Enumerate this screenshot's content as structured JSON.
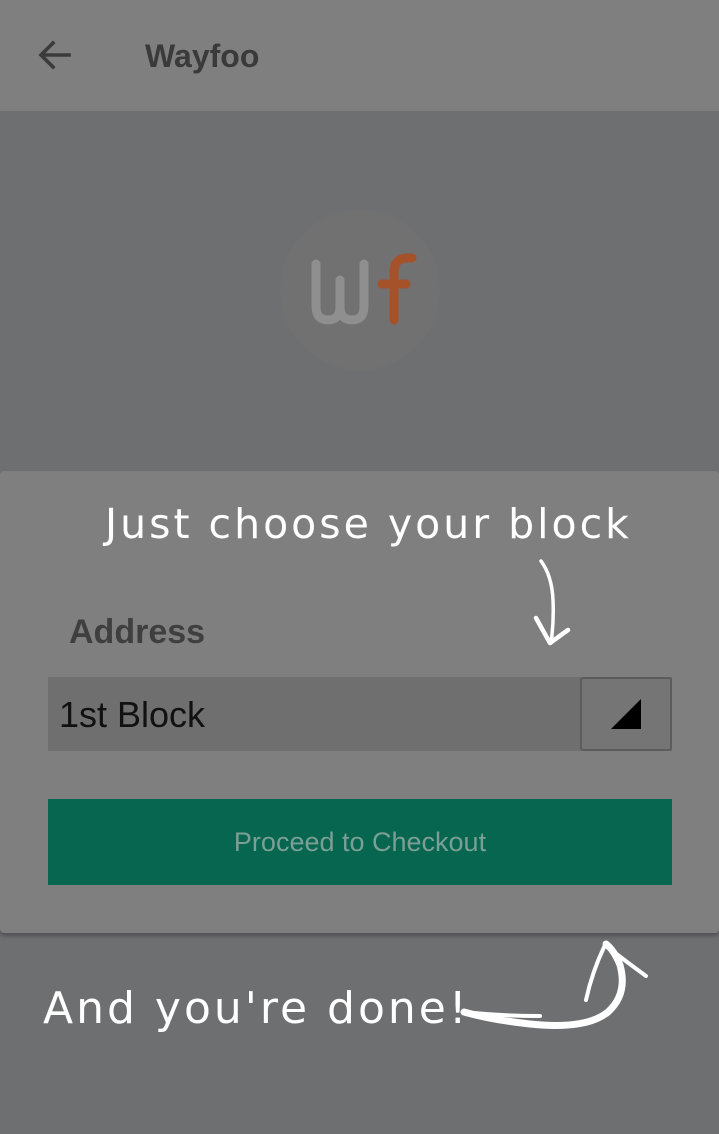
{
  "app_bar": {
    "title": "Wayfoo",
    "back_icon": "arrow-back-icon"
  },
  "logo": {
    "text_left": "w",
    "text_right": "f",
    "color_left": "#8f8f8f",
    "color_right": "#a5522b"
  },
  "form": {
    "address_label": "Address",
    "address_selected": "1st Block",
    "dropdown_icon": "dropdown-triangle-icon",
    "checkout_label": "Proceed to Checkout",
    "checkout_color": "#066650"
  },
  "annotations": {
    "top_hint": "Just choose your block",
    "bottom_hint": "And you're done!"
  }
}
